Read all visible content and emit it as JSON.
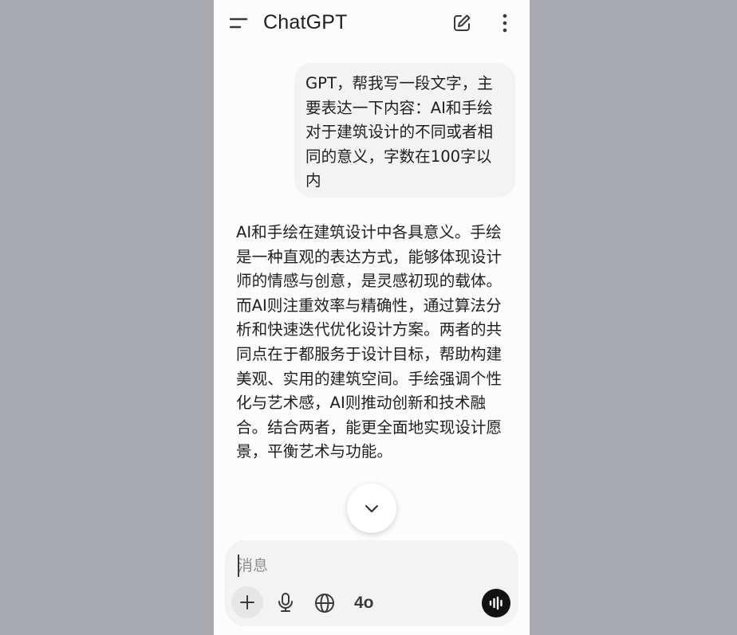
{
  "app": {
    "title": "ChatGPT"
  },
  "conversation": {
    "user_message": "GPT，帮我写一段文字，主要表达一下内容：AI和手绘对于建筑设计的不同或者相同的意义，字数在100字以内",
    "assistant_message": "AI和手绘在建筑设计中各具意义。手绘是一种直观的表达方式，能够体现设计师的情感与创意，是灵感初现的载体。而AI则注重效率与精确性，通过算法分析和快速迭代优化设计方案。两者的共同点在于都服务于设计目标，帮助构建美观、实用的建筑空间。手绘强调个性化与艺术感，AI则推动创新和技术融合。结合两者，能更全面地实现设计愿景，平衡艺术与功能。"
  },
  "composer": {
    "placeholder": "消息",
    "value": "",
    "model_label": "4o"
  },
  "icons": {
    "menu": "menu-icon",
    "new_chat": "edit-icon",
    "more": "more-vertical-icon",
    "scroll_down": "chevron-down-icon",
    "plus": "plus-icon",
    "mic": "mic-icon",
    "globe": "globe-icon",
    "voice": "voice-wave-icon"
  },
  "colors": {
    "background_outside": "#a9aab0",
    "surface": "#fcfcfc",
    "bubble": "#f3f3f3",
    "text": "#1f1f1f",
    "voice_button": "#121212"
  }
}
